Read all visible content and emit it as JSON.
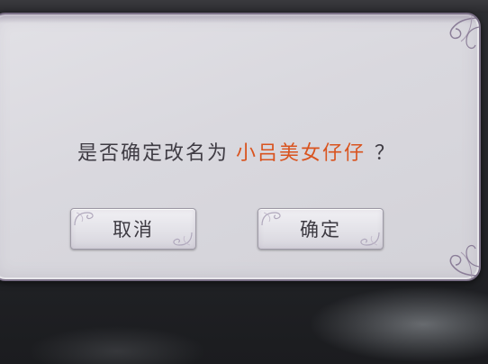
{
  "dialog": {
    "message_prefix": "是否确定改名为",
    "new_name": "小吕美女仔仔",
    "message_suffix": "？",
    "cancel_label": "取消",
    "confirm_label": "确定"
  },
  "colors": {
    "dialog_bg": "#dedde3",
    "dialog_border": "#7a6f86",
    "text": "#3f3c44",
    "highlight_name": "#d9531e",
    "scene_bg": "#232428"
  },
  "icons": {
    "corner_decoration": "ornate-flourish-icon",
    "button_decoration": "swirl-ornament-icon"
  }
}
